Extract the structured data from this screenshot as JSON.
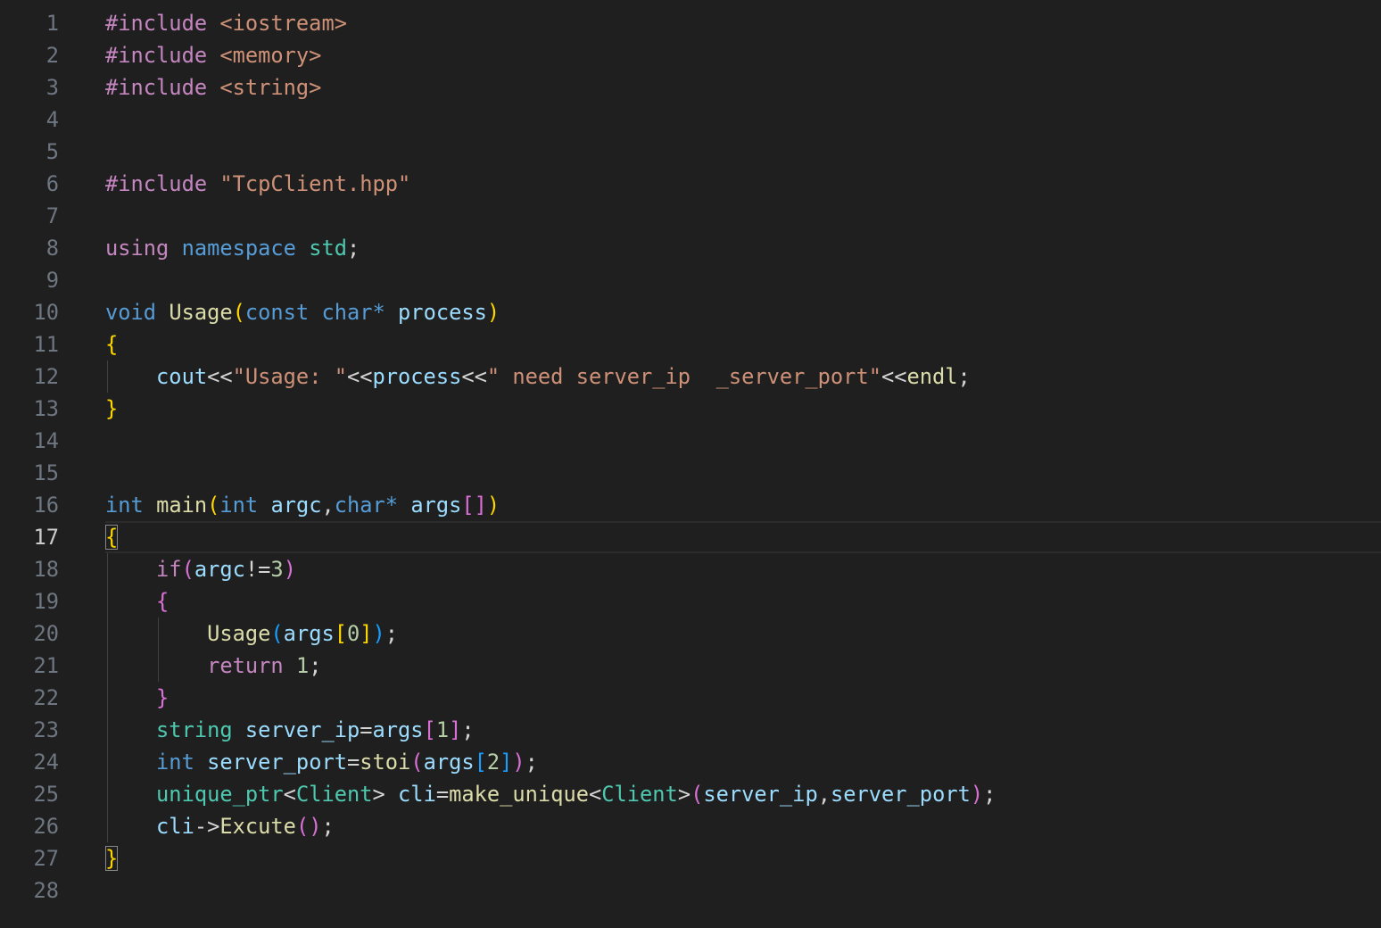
{
  "editor": {
    "language": "cpp",
    "active_line": 17,
    "lines": [
      {
        "n": "1",
        "indent": 0,
        "tokens": [
          [
            "kw",
            "#include"
          ],
          [
            "p",
            " "
          ],
          [
            "inc",
            "<iostream>"
          ]
        ]
      },
      {
        "n": "2",
        "indent": 0,
        "tokens": [
          [
            "kw",
            "#include"
          ],
          [
            "p",
            " "
          ],
          [
            "inc",
            "<memory>"
          ]
        ]
      },
      {
        "n": "3",
        "indent": 0,
        "tokens": [
          [
            "kw",
            "#include"
          ],
          [
            "p",
            " "
          ],
          [
            "inc",
            "<string>"
          ]
        ]
      },
      {
        "n": "4",
        "indent": 0,
        "tokens": []
      },
      {
        "n": "5",
        "indent": 0,
        "tokens": []
      },
      {
        "n": "6",
        "indent": 0,
        "tokens": [
          [
            "kw",
            "#include"
          ],
          [
            "p",
            " "
          ],
          [
            "str",
            "\"TcpClient.hpp\""
          ]
        ]
      },
      {
        "n": "7",
        "indent": 0,
        "tokens": []
      },
      {
        "n": "8",
        "indent": 0,
        "tokens": [
          [
            "kw",
            "using"
          ],
          [
            "p",
            " "
          ],
          [
            "type",
            "namespace"
          ],
          [
            "p",
            " "
          ],
          [
            "cls",
            "std"
          ],
          [
            "p",
            ";"
          ]
        ]
      },
      {
        "n": "9",
        "indent": 0,
        "tokens": []
      },
      {
        "n": "10",
        "indent": 0,
        "tokens": [
          [
            "type",
            "void"
          ],
          [
            "p",
            " "
          ],
          [
            "fn",
            "Usage"
          ],
          [
            "b1",
            "("
          ],
          [
            "type",
            "const"
          ],
          [
            "p",
            " "
          ],
          [
            "type",
            "char"
          ],
          [
            "type",
            "*"
          ],
          [
            "p",
            " "
          ],
          [
            "var",
            "process"
          ],
          [
            "b1",
            ")"
          ]
        ]
      },
      {
        "n": "11",
        "indent": 0,
        "tokens": [
          [
            "b1",
            "{"
          ]
        ]
      },
      {
        "n": "12",
        "indent": 1,
        "tokens": [
          [
            "var",
            "cout"
          ],
          [
            "p",
            "<<"
          ],
          [
            "str",
            "\"Usage: \""
          ],
          [
            "p",
            "<<"
          ],
          [
            "var",
            "process"
          ],
          [
            "p",
            "<<"
          ],
          [
            "str",
            "\" need server_ip  _server_port\""
          ],
          [
            "p",
            "<<"
          ],
          [
            "fn",
            "endl"
          ],
          [
            "p",
            ";"
          ]
        ]
      },
      {
        "n": "13",
        "indent": 0,
        "tokens": [
          [
            "b1",
            "}"
          ]
        ]
      },
      {
        "n": "14",
        "indent": 0,
        "tokens": []
      },
      {
        "n": "15",
        "indent": 0,
        "tokens": []
      },
      {
        "n": "16",
        "indent": 0,
        "tokens": [
          [
            "type",
            "int"
          ],
          [
            "p",
            " "
          ],
          [
            "fn",
            "main"
          ],
          [
            "b1",
            "("
          ],
          [
            "type",
            "int"
          ],
          [
            "p",
            " "
          ],
          [
            "var",
            "argc"
          ],
          [
            "p",
            ","
          ],
          [
            "type",
            "char"
          ],
          [
            "type",
            "*"
          ],
          [
            "p",
            " "
          ],
          [
            "var",
            "args"
          ],
          [
            "b2",
            "[]"
          ],
          [
            "b1",
            ")"
          ]
        ]
      },
      {
        "n": "17",
        "indent": 0,
        "tokens": [
          [
            "b1m",
            "{"
          ]
        ]
      },
      {
        "n": "18",
        "indent": 1,
        "tokens": [
          [
            "kw",
            "if"
          ],
          [
            "b2",
            "("
          ],
          [
            "var",
            "argc"
          ],
          [
            "p",
            "!="
          ],
          [
            "num",
            "3"
          ],
          [
            "b2",
            ")"
          ]
        ]
      },
      {
        "n": "19",
        "indent": 1,
        "tokens": [
          [
            "b2",
            "{"
          ]
        ]
      },
      {
        "n": "20",
        "indent": 2,
        "tokens": [
          [
            "fn",
            "Usage"
          ],
          [
            "b3",
            "("
          ],
          [
            "var",
            "args"
          ],
          [
            "b1",
            "["
          ],
          [
            "num",
            "0"
          ],
          [
            "b1",
            "]"
          ],
          [
            "b3",
            ")"
          ],
          [
            "p",
            ";"
          ]
        ]
      },
      {
        "n": "21",
        "indent": 2,
        "tokens": [
          [
            "kw",
            "return"
          ],
          [
            "p",
            " "
          ],
          [
            "num",
            "1"
          ],
          [
            "p",
            ";"
          ]
        ]
      },
      {
        "n": "22",
        "indent": 1,
        "tokens": [
          [
            "b2",
            "}"
          ]
        ]
      },
      {
        "n": "23",
        "indent": 1,
        "tokens": [
          [
            "cls",
            "string"
          ],
          [
            "p",
            " "
          ],
          [
            "var",
            "server_ip"
          ],
          [
            "p",
            "="
          ],
          [
            "var",
            "args"
          ],
          [
            "b2",
            "["
          ],
          [
            "num",
            "1"
          ],
          [
            "b2",
            "]"
          ],
          [
            "p",
            ";"
          ]
        ]
      },
      {
        "n": "24",
        "indent": 1,
        "tokens": [
          [
            "type",
            "int"
          ],
          [
            "p",
            " "
          ],
          [
            "var",
            "server_port"
          ],
          [
            "p",
            "="
          ],
          [
            "fn",
            "stoi"
          ],
          [
            "b2",
            "("
          ],
          [
            "var",
            "args"
          ],
          [
            "b3",
            "["
          ],
          [
            "num",
            "2"
          ],
          [
            "b3",
            "]"
          ],
          [
            "b2",
            ")"
          ],
          [
            "p",
            ";"
          ]
        ]
      },
      {
        "n": "25",
        "indent": 1,
        "tokens": [
          [
            "cls",
            "unique_ptr"
          ],
          [
            "p",
            "<"
          ],
          [
            "cls",
            "Client"
          ],
          [
            "p",
            "> "
          ],
          [
            "var",
            "cli"
          ],
          [
            "p",
            "="
          ],
          [
            "fn",
            "make_unique"
          ],
          [
            "p",
            "<"
          ],
          [
            "cls",
            "Client"
          ],
          [
            "p",
            ">"
          ],
          [
            "b2",
            "("
          ],
          [
            "var",
            "server_ip"
          ],
          [
            "p",
            ","
          ],
          [
            "var",
            "server_port"
          ],
          [
            "b2",
            ")"
          ],
          [
            "p",
            ";"
          ]
        ]
      },
      {
        "n": "26",
        "indent": 1,
        "tokens": [
          [
            "var",
            "cli"
          ],
          [
            "p",
            "->"
          ],
          [
            "fn",
            "Excute"
          ],
          [
            "b2",
            "()"
          ],
          [
            "p",
            ";"
          ]
        ]
      },
      {
        "n": "27",
        "indent": 0,
        "tokens": [
          [
            "b1m",
            "}"
          ]
        ]
      },
      {
        "n": "28",
        "indent": 0,
        "tokens": []
      }
    ]
  },
  "colors": {
    "background": "#1f1f1f",
    "line_number": "#6e7681",
    "line_number_active": "#cccccc",
    "keyword_control": "#c586c0",
    "string": "#ce9178",
    "keyword_type": "#569cd6",
    "class_name": "#4ec9b0",
    "function": "#dcdcaa",
    "variable": "#9cdcfe",
    "number": "#b5cea8",
    "punctuation": "#d4d4d4",
    "bracket_level_1": "#ffd700",
    "bracket_level_2": "#da70d6",
    "bracket_level_3": "#179fff"
  }
}
